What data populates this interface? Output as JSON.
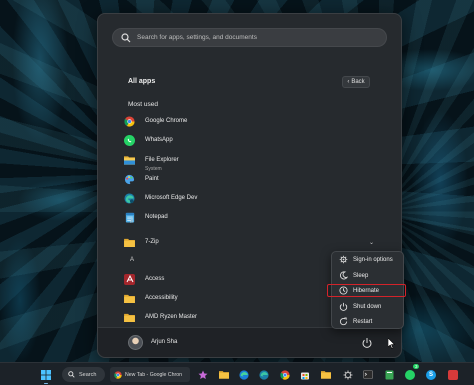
{
  "search": {
    "placeholder": "Search for apps, settings, and documents"
  },
  "header": {
    "title": "All apps",
    "back_label": "Back"
  },
  "most_used": {
    "label": "Most used",
    "items": [
      {
        "name": "Google Chrome",
        "icon": "chrome-icon"
      },
      {
        "name": "WhatsApp",
        "icon": "whatsapp-icon"
      },
      {
        "name": "File Explorer",
        "sub": "System",
        "icon": "folder-icon"
      },
      {
        "name": "Paint",
        "icon": "paint-icon"
      },
      {
        "name": "Microsoft Edge Dev",
        "icon": "edge-dev-icon"
      },
      {
        "name": "Notepad",
        "icon": "notepad-icon"
      }
    ]
  },
  "groups": [
    {
      "letter": "#",
      "items": [
        {
          "name": "7-Zip",
          "icon": "folder-icon"
        }
      ]
    },
    {
      "letter": "A",
      "items": [
        {
          "name": "Access",
          "icon": "access-icon"
        },
        {
          "name": "Accessibility",
          "icon": "folder-icon"
        },
        {
          "name": "AMD Ryzen Master",
          "icon": "folder-icon"
        }
      ]
    }
  ],
  "user": {
    "name": "Arjun Sha"
  },
  "power_menu": {
    "items": [
      {
        "label": "Sign-in options",
        "icon": "gear-icon"
      },
      {
        "label": "Sleep",
        "icon": "moon-icon"
      },
      {
        "label": "Hibernate",
        "icon": "clock-icon"
      },
      {
        "label": "Shut down",
        "icon": "power-icon"
      },
      {
        "label": "Restart",
        "icon": "restart-icon"
      }
    ],
    "highlighted": "Hibernate"
  },
  "taskbar": {
    "search_label": "Search",
    "chrome_tab_label": "New Tab - Google Chron",
    "whatsapp_badge": "3"
  },
  "colors": {
    "highlight": "#d4232a",
    "accent": "#7ab8e6"
  }
}
